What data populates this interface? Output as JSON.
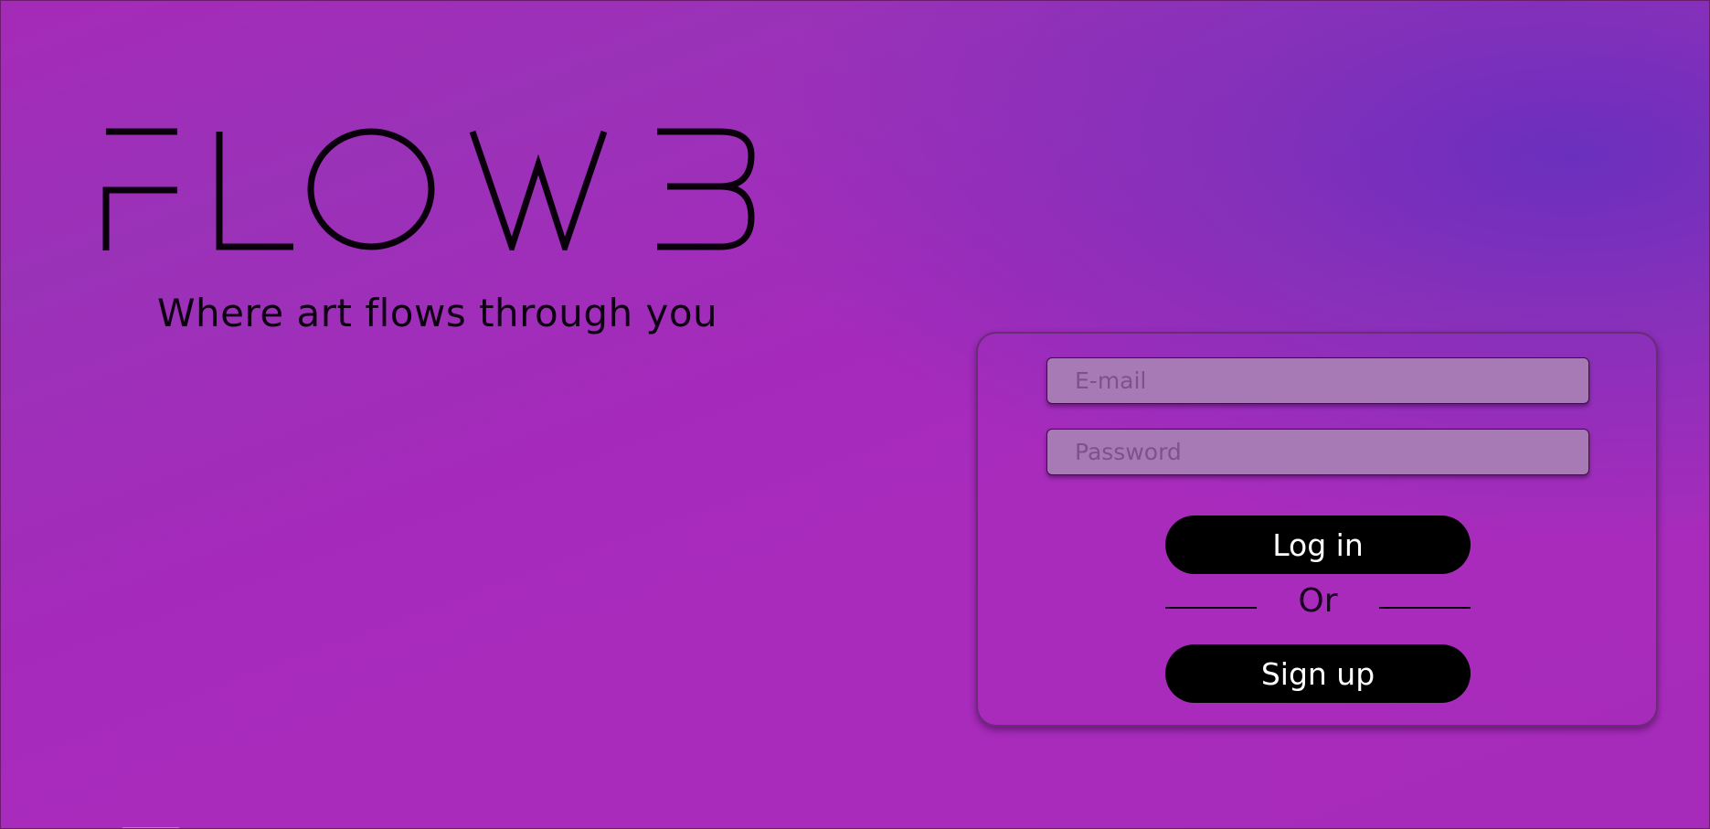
{
  "brand": {
    "logo_text": "FLOW3",
    "tagline": "Where art flows through you"
  },
  "login_form": {
    "email_placeholder": "E-mail",
    "password_placeholder": "Password",
    "login_label": "Log in",
    "divider_label": "Or",
    "signup_label": "Sign up"
  },
  "colors": {
    "background_primary": "#a82bbc",
    "background_accent": "#6a32bd",
    "input_fill": "#a77ab6",
    "button_fill": "#000000",
    "button_text": "#ffffff"
  }
}
